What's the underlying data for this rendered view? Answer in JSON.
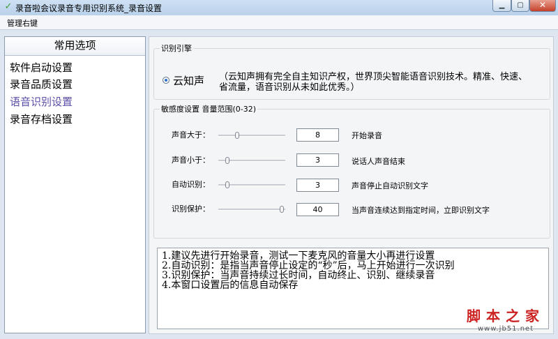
{
  "window": {
    "title": "录音啦会议录音专用识别系统_录音设置",
    "minimize_glyph": "▁",
    "maximize_glyph": "▢",
    "close_glyph": "✕",
    "app_icon": "✓"
  },
  "menu": {
    "item": "管理右键"
  },
  "sidebar": {
    "header": "常用选项",
    "items": [
      {
        "label": "软件启动设置",
        "active": false
      },
      {
        "label": "录音品质设置",
        "active": false
      },
      {
        "label": "语音识别设置",
        "active": true
      },
      {
        "label": "录音存档设置",
        "active": false
      }
    ]
  },
  "engine": {
    "legend": "识别引擎",
    "option_label": "云知声",
    "option_selected": true,
    "description": "（云知声拥有完全自主知识产权，世界顶尖智能语音识别技术。精准、快速、省流量，语音识别从未如此优秀。）"
  },
  "sensitivity": {
    "legend": "敏感度设置 音量范围(0-32)",
    "rows": [
      {
        "label": "声音大于：",
        "value": "8",
        "desc": "开始录音",
        "level": 8
      },
      {
        "label": "声音小于：",
        "value": "3",
        "desc": "说话人声音结束",
        "level": 3
      },
      {
        "label": "自动识别：",
        "value": "3",
        "desc": "声音停止自动识别文字",
        "level": 3
      },
      {
        "label": "识别保护：",
        "value": "40",
        "desc": "当声音连续达到指定时间，立即识别文字",
        "level": 40
      }
    ]
  },
  "tips": "1.建议先进行开始录音，测试一下麦克风的音量大小再进行设置\n2.自动识别：是指当声音停止设定的“秒”后，马上开始进行一次识别\n3.识别保护：当声音持续过长时间，自动终止、识别、继续录音\n4.本窗口设置后的信息自动保存",
  "watermark": {
    "main": "脚本之家",
    "sub": "www.jb51.net"
  },
  "colors": {
    "active_nav": "#5a4fa8",
    "radio_dot": "#2c6fcc",
    "close_button": "#c4402a",
    "watermark": "#cc2222"
  }
}
